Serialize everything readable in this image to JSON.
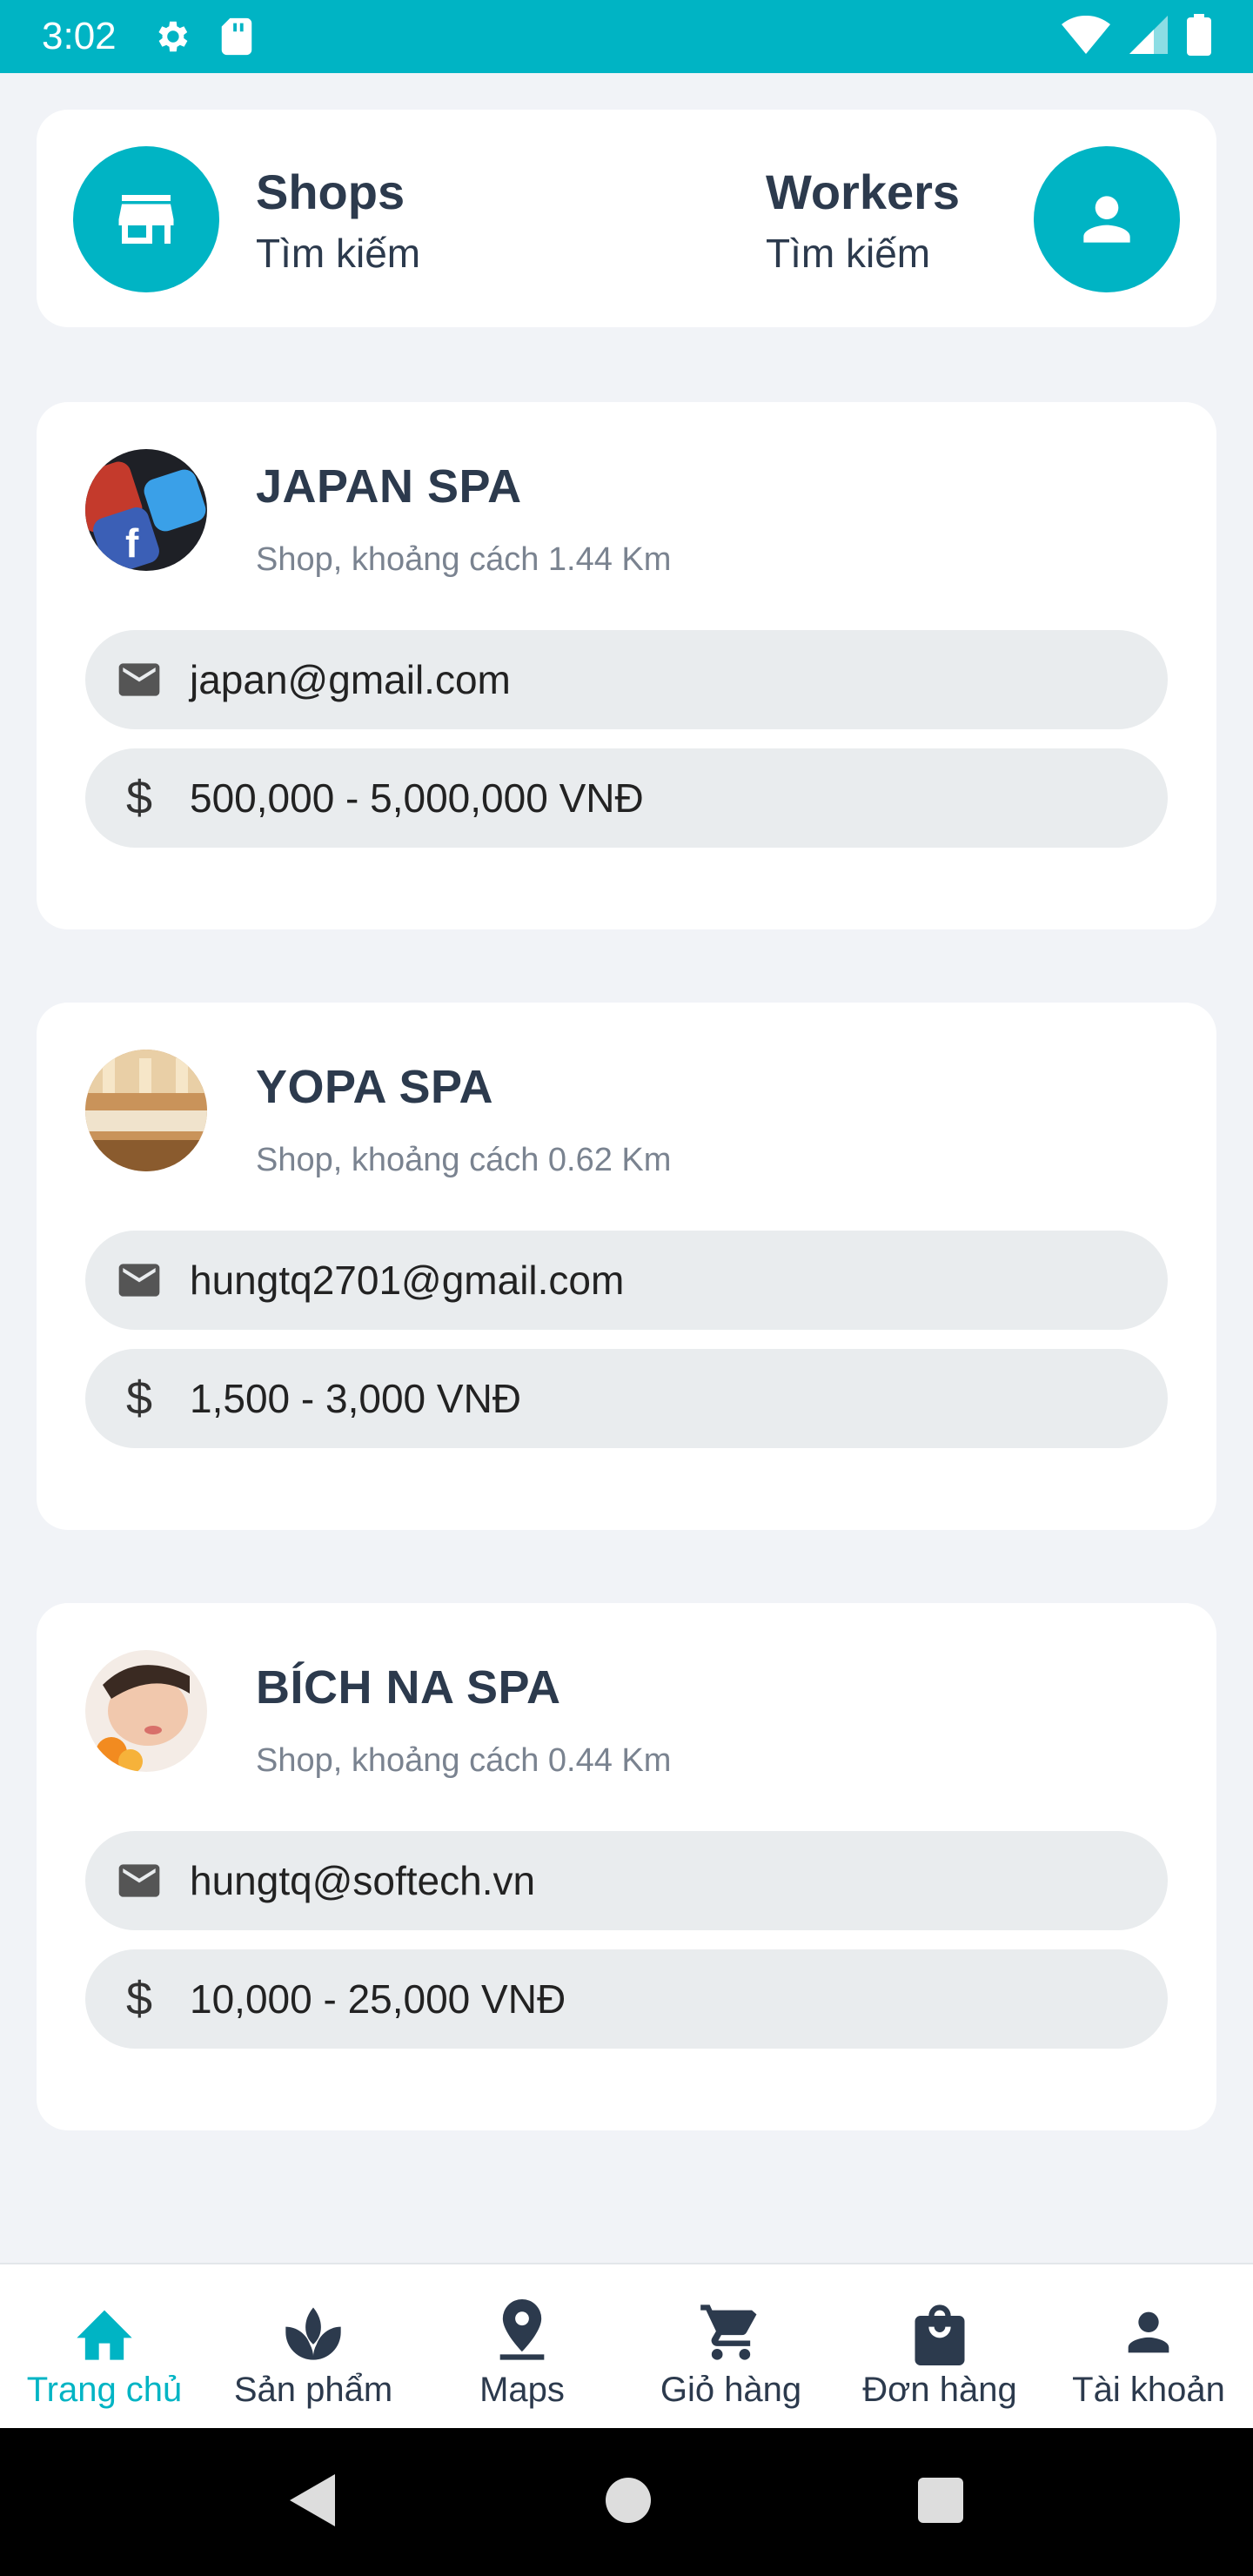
{
  "status_bar": {
    "time": "3:02"
  },
  "quick": {
    "shops": {
      "title": "Shops",
      "subtitle": "Tìm kiếm"
    },
    "workers": {
      "title": "Workers",
      "subtitle": "Tìm kiếm"
    }
  },
  "shops": [
    {
      "name": "JAPAN SPA",
      "subtitle": "Shop, khoảng cách 1.44 Km",
      "email": "japan@gmail.com",
      "price": "500,000 - 5,000,000 VNĐ"
    },
    {
      "name": "YOPA SPA",
      "subtitle": "Shop, khoảng cách 0.62 Km",
      "email": "hungtq2701@gmail.com",
      "price": "1,500 - 3,000 VNĐ"
    },
    {
      "name": "BÍCH NA SPA",
      "subtitle": "Shop, khoảng cách 0.44 Km",
      "email": "hungtq@softech.vn",
      "price": "10,000 - 25,000 VNĐ"
    }
  ],
  "price_symbol": "$",
  "bottom_nav": [
    {
      "label": "Trang chủ",
      "icon": "home-icon",
      "active": true
    },
    {
      "label": "Sản phẩm",
      "icon": "lotus-icon",
      "active": false
    },
    {
      "label": "Maps",
      "icon": "map-pin-icon",
      "active": false
    },
    {
      "label": "Giỏ hàng",
      "icon": "cart-icon",
      "active": false
    },
    {
      "label": "Đơn hàng",
      "icon": "shopping-bag-icon",
      "active": false
    },
    {
      "label": "Tài khoản",
      "icon": "person-icon",
      "active": false
    }
  ],
  "colors": {
    "accent": "#00b4c4",
    "text": "#2c3a4d",
    "background": "#f1f3f7",
    "pill": "#e9ecee"
  }
}
